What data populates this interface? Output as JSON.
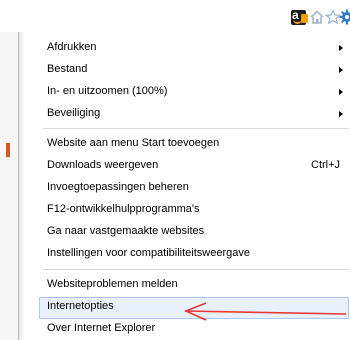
{
  "toolbar": {
    "icons": [
      "amazon-icon",
      "home-icon",
      "favorites-star-icon",
      "tools-gear-icon"
    ],
    "amazon_letter": "a"
  },
  "menu": {
    "items": [
      {
        "label": "Afdrukken",
        "submenu": true
      },
      {
        "label": "Bestand",
        "submenu": true
      },
      {
        "label": "In- en uitzoomen (100%)",
        "submenu": true
      },
      {
        "label": "Beveiliging",
        "submenu": true
      },
      {
        "label": "Website aan menu Start toevoegen"
      },
      {
        "label": "Downloads weergeven",
        "shortcut": "Ctrl+J"
      },
      {
        "label": "Invoegtoepassingen beheren"
      },
      {
        "label": "F12-ontwikkelhulpprogramma's"
      },
      {
        "label": "Ga naar vastgemaakte websites"
      },
      {
        "label": "Instellingen voor compatibiliteitsweergave"
      },
      {
        "label": "Websiteproblemen melden"
      },
      {
        "label": "Internetopties",
        "highlighted": true
      },
      {
        "label": "Over Internet Explorer"
      }
    ]
  },
  "colors": {
    "callout_arrow": "#e53935",
    "highlight_bg": "#e8f1fb",
    "highlight_border": "#aac9ee",
    "separator": "#d9d9d9"
  }
}
